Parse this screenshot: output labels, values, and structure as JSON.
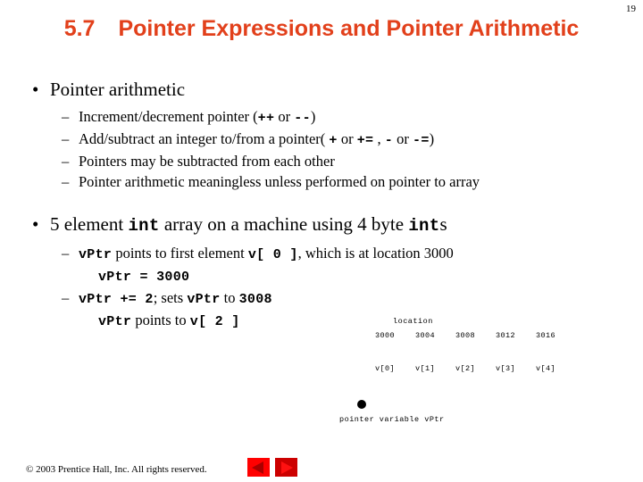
{
  "slide": {
    "page_number": "19",
    "title": {
      "number": "5.7",
      "text": "Pointer Expressions and Pointer Arithmetic",
      "color": "#E2401B"
    }
  },
  "content": {
    "bullet_glyph": "•",
    "dash_glyph": "–",
    "group1": {
      "heading": "Pointer arithmetic",
      "items": [
        {
          "parts": [
            {
              "text": "Increment/decrement pointer  (",
              "style": "text"
            },
            {
              "text": "++",
              "style": "code"
            },
            {
              "text": " or ",
              "style": "text"
            },
            {
              "text": "--",
              "style": "code"
            },
            {
              "text": ")",
              "style": "text"
            }
          ]
        },
        {
          "parts": [
            {
              "text": "Add/subtract an integer to/from a pointer( ",
              "style": "text"
            },
            {
              "text": "+",
              "style": "code"
            },
            {
              "text": " or ",
              "style": "text"
            },
            {
              "text": "+=",
              "style": "code"
            },
            {
              "text": " , ",
              "style": "text"
            },
            {
              "text": "-",
              "style": "code"
            },
            {
              "text": " or ",
              "style": "text"
            },
            {
              "text": "-=",
              "style": "code"
            },
            {
              "text": ")",
              "style": "text"
            }
          ]
        },
        {
          "parts": [
            {
              "text": "Pointers may be subtracted from each other",
              "style": "text"
            }
          ]
        },
        {
          "parts": [
            {
              "text": "Pointer arithmetic meaningless unless performed on pointer to array",
              "style": "text"
            }
          ]
        }
      ]
    },
    "group2": {
      "heading_parts": [
        {
          "text": "5 element ",
          "style": "text"
        },
        {
          "text": "int",
          "style": "code"
        },
        {
          "text": " array on a machine using 4 byte ",
          "style": "text"
        },
        {
          "text": "int",
          "style": "code"
        },
        {
          "text": "s",
          "style": "text"
        }
      ],
      "items": [
        {
          "kind": "dash",
          "parts": [
            {
              "text": "vPtr",
              "style": "code"
            },
            {
              "text": " points to first element ",
              "style": "text"
            },
            {
              "text": "v[ 0 ]",
              "style": "code"
            },
            {
              "text": ", which is at location 3000",
              "style": "text"
            }
          ]
        },
        {
          "kind": "plain",
          "parts": [
            {
              "text": "vPtr = 3000",
              "style": "code"
            }
          ]
        },
        {
          "kind": "dash",
          "parts": [
            {
              "text": "vPtr += 2",
              "style": "code"
            },
            {
              "text": "; sets ",
              "style": "text"
            },
            {
              "text": "vPtr",
              "style": "code"
            },
            {
              "text": " to ",
              "style": "text"
            },
            {
              "text": "3008",
              "style": "code"
            }
          ]
        },
        {
          "kind": "plain",
          "parts": [
            {
              "text": "vPtr",
              "style": "code"
            },
            {
              "text": " points to ",
              "style": "text"
            },
            {
              "text": "v[ 2 ]",
              "style": "code"
            }
          ]
        }
      ]
    }
  },
  "diagram": {
    "location_label": "location",
    "addresses": [
      "3000",
      "3004",
      "3008",
      "3012",
      "3016"
    ],
    "elements": [
      "v[0]",
      "v[1]",
      "v[2]",
      "v[3]",
      "v[4]"
    ],
    "pointer_caption": "pointer variable vPtr"
  },
  "footer": {
    "copyright": "© 2003 Prentice Hall, Inc.  All rights reserved.",
    "prev_label": "previous slide",
    "next_label": "next slide"
  }
}
